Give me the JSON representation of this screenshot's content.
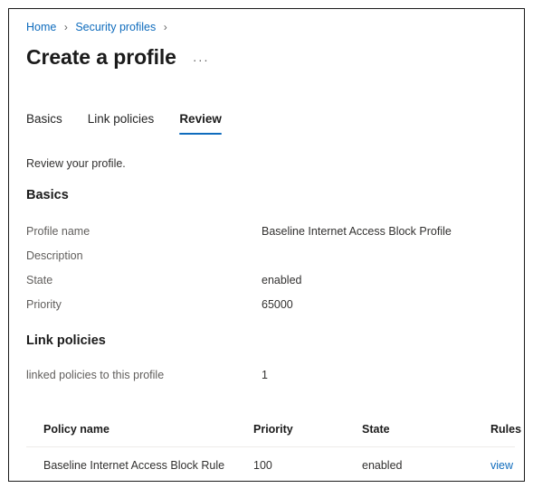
{
  "breadcrumb": {
    "items": [
      {
        "label": "Home",
        "is_link": true
      },
      {
        "label": "Security profiles",
        "is_link": true
      }
    ],
    "separator": "›",
    "trailing_separator": "›"
  },
  "header": {
    "title": "Create a profile",
    "more_menu": "···"
  },
  "tabs": [
    {
      "label": "Basics",
      "active": false
    },
    {
      "label": "Link policies",
      "active": false
    },
    {
      "label": "Review",
      "active": true
    }
  ],
  "intro": "Review your profile.",
  "sections": {
    "basics": {
      "heading": "Basics",
      "rows": [
        {
          "label": "Profile name",
          "value": "Baseline Internet Access Block Profile"
        },
        {
          "label": "Description",
          "value": ""
        },
        {
          "label": "State",
          "value": "enabled"
        },
        {
          "label": "Priority",
          "value": "65000"
        }
      ]
    },
    "link_policies": {
      "heading": "Link policies",
      "rows": [
        {
          "label": "linked policies to this profile",
          "value": "1"
        }
      ],
      "table": {
        "columns": [
          "Policy name",
          "Priority",
          "State",
          "Rules"
        ],
        "rows": [
          {
            "policy_name": "Baseline Internet Access Block Rule",
            "priority": "100",
            "state": "enabled",
            "rules": "view"
          }
        ]
      }
    }
  },
  "colors": {
    "link": "#0f6cbd",
    "accent_underline": "#0f6cbd",
    "text_primary": "#1b1b1b",
    "text_secondary": "#605e5c",
    "border": "#1b1b1b",
    "rule": "#edebe9"
  }
}
